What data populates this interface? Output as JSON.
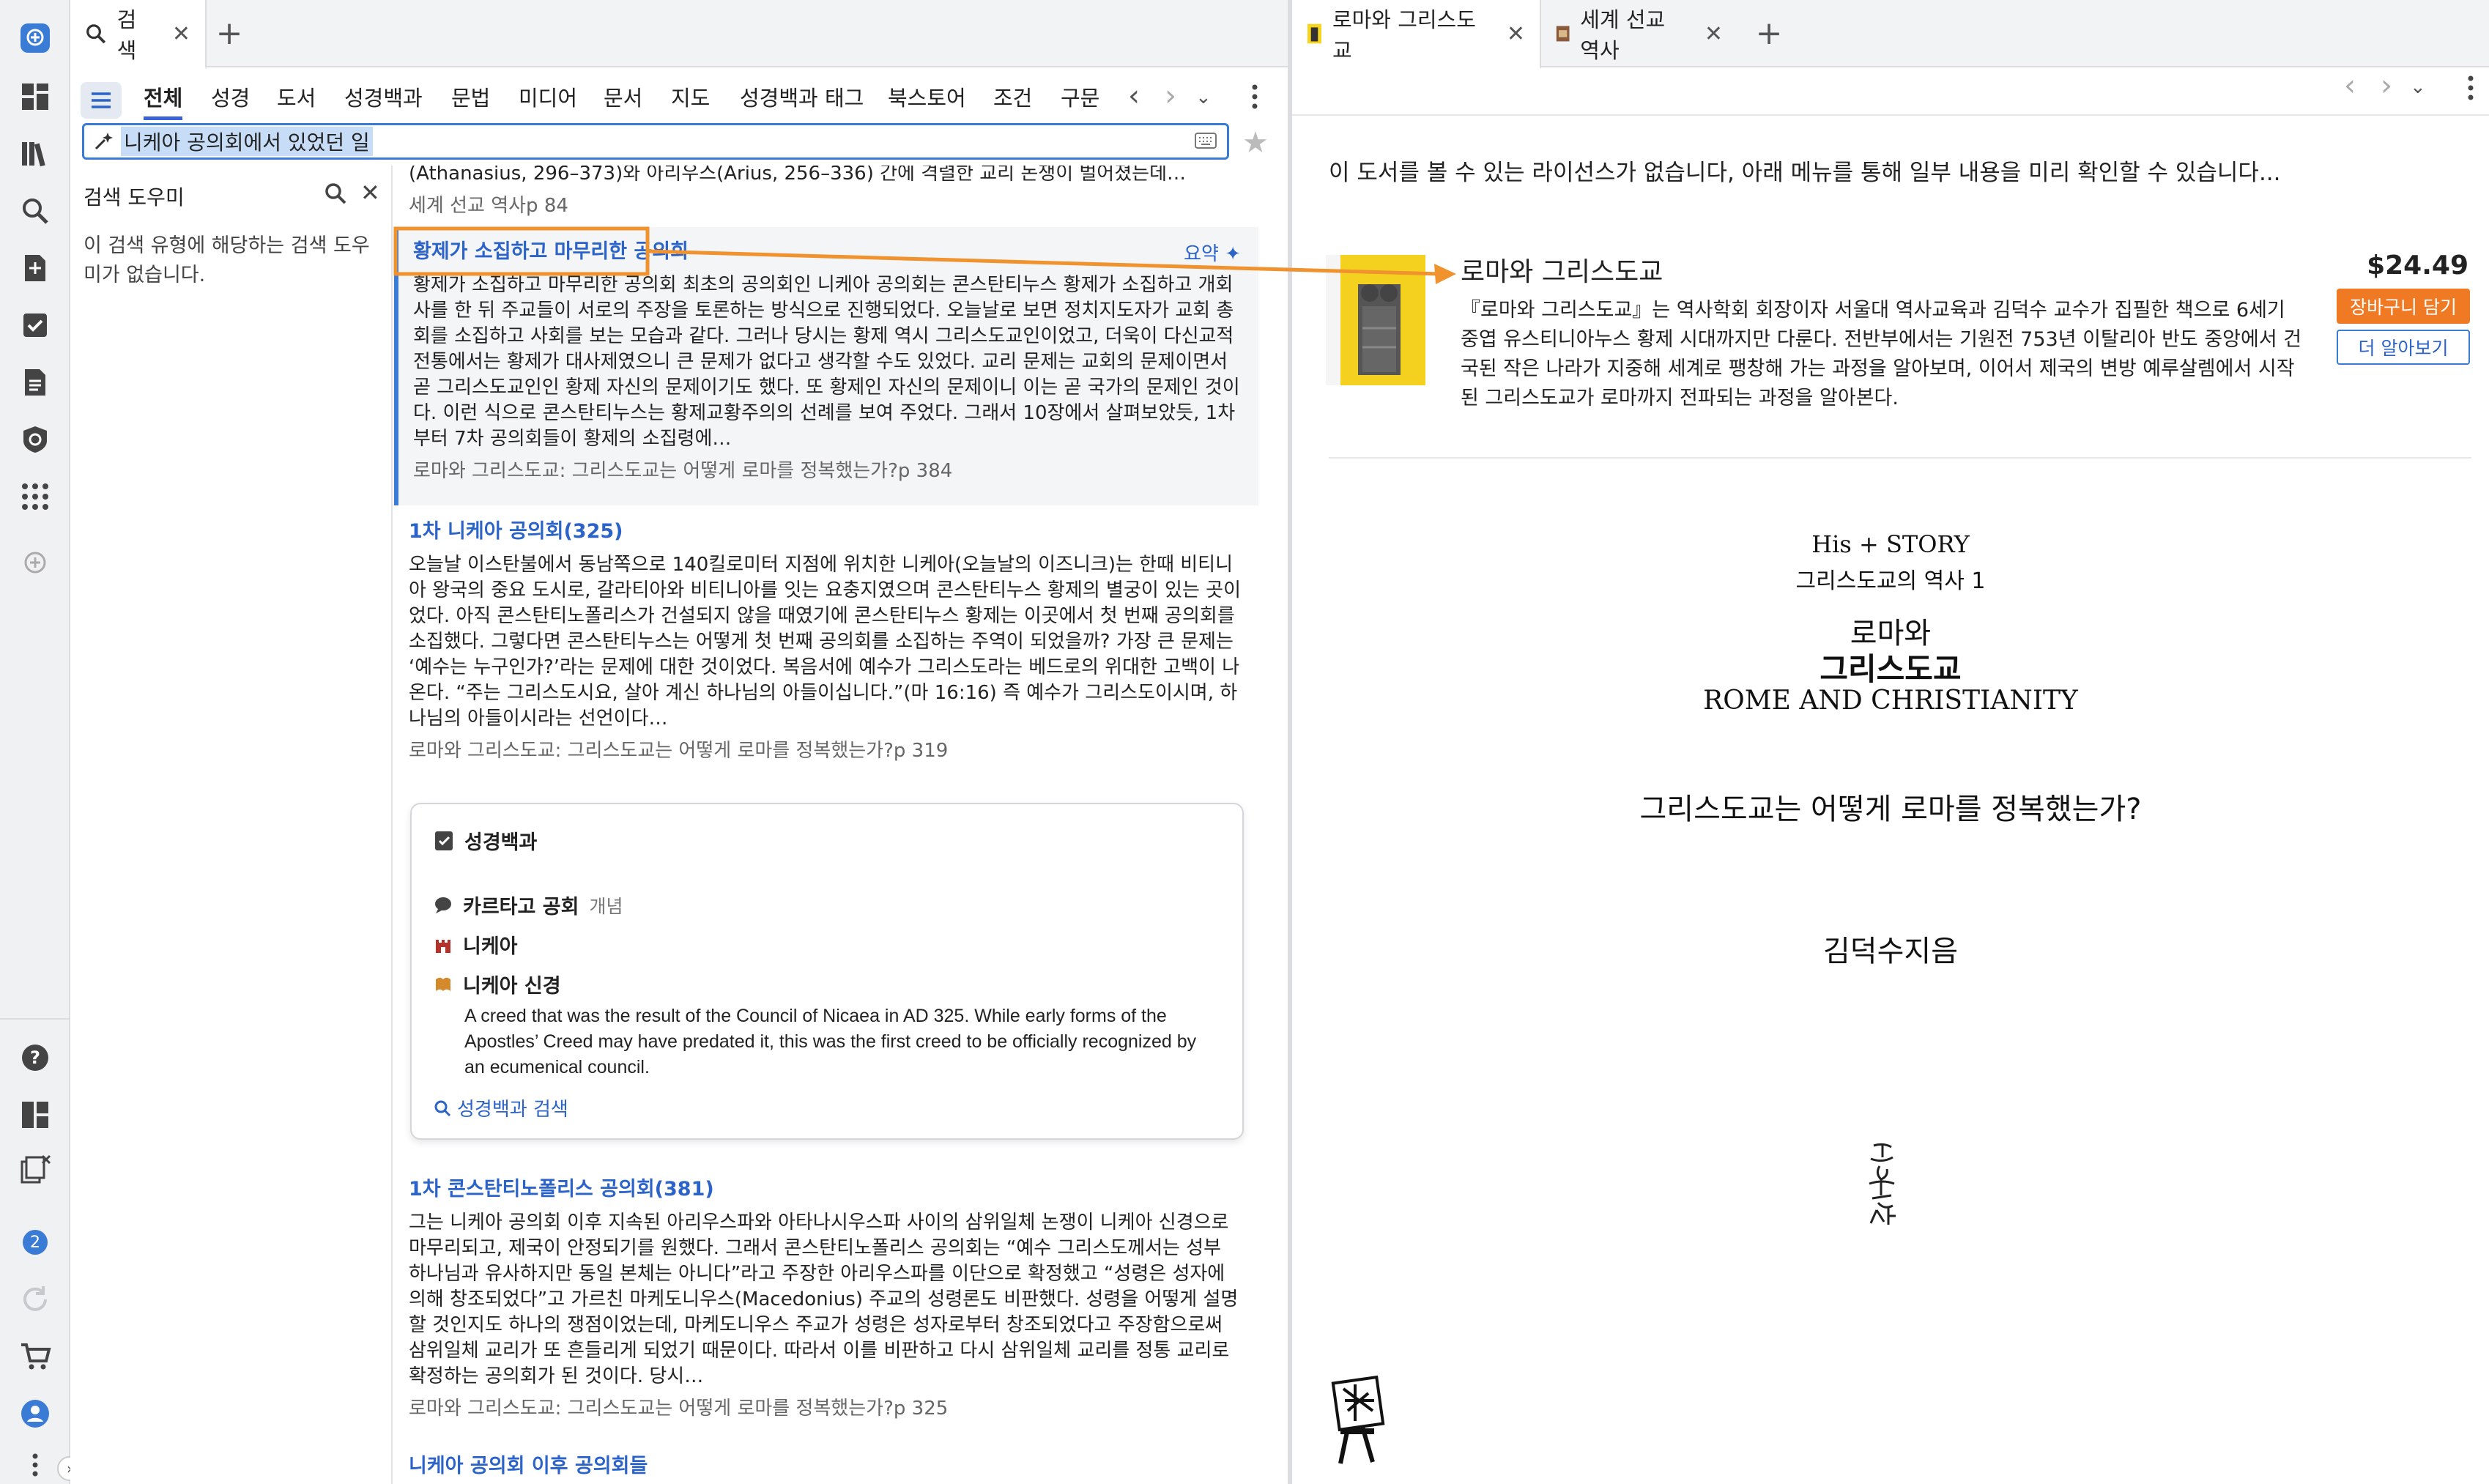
{
  "left_tabs": [
    {
      "label": "검색",
      "icon": "search-icon"
    }
  ],
  "filter_tabs": [
    "전체",
    "성경",
    "도서",
    "성경백과",
    "문법",
    "미디어",
    "문서",
    "지도",
    "성경백과 태그",
    "북스토어",
    "조건",
    "구문"
  ],
  "search": {
    "query": "니케아 공의회에서 있었던 일",
    "placeholder": ""
  },
  "helper": {
    "title": "검색 도우미",
    "message": "이 검색 유형에 해당하는 검색 도우미가 없습니다."
  },
  "results": {
    "top_partial_text": "(Athanasius, 296–373)와 아리우스(Arius, 256–336) 간에 격렬한 교리 논쟁이 벌어졌는데…",
    "top_partial_src": "세계 선교 역사p 84",
    "items": [
      {
        "title": "황제가 소집하고 마무리한 공의회",
        "summary_label": "요약",
        "body": "황제가 소집하고 마무리한 공의회 최초의 공의회인 니케아 공의회는 콘스탄티누스 황제가 소집하고 개회사를 한 뒤 주교들이 서로의 주장을 토론하는 방식으로 진행되었다. 오늘날로 보면 정치지도자가 교회 총회를 소집하고 사회를 보는 모습과 같다. 그러나 당시는 황제 역시 그리스도교인이었고, 더욱이 다신교적 전통에서는 황제가 대사제였으니 큰 문제가 없다고 생각할 수도 있었다. 교리 문제는 교회의 문제이면서 곧 그리스도교인인 황제 자신의 문제이기도 했다. 또 황제인 자신의 문제이니 이는 곧 국가의 문제인 것이다. 이런 식으로 콘스탄티누스는 황제교황주의의 선례를 보여 주었다. 그래서 10장에서 살펴보았듯, 1차부터 7차 공의회들이 황제의 소집령에…",
        "source": "로마와 그리스도교: 그리스도교는 어떻게 로마를 정복했는가?p 384"
      },
      {
        "title": "1차 니케아 공의회(325)",
        "body": "오늘날 이스탄불에서 동남쪽으로 140킬로미터 지점에 위치한 니케아(오늘날의 이즈니크)는 한때 비티니아 왕국의 중요 도시로, 갈라티아와 비티니아를 잇는 요충지였으며 콘스탄티누스 황제의 별궁이 있는 곳이었다. 아직 콘스탄티노폴리스가 건설되지 않을 때였기에 콘스탄티누스 황제는 이곳에서 첫 번째 공의회를 소집했다. 그렇다면 콘스탄티누스는 어떻게 첫 번째 공의회를 소집하는 주역이 되었을까? 가장 큰 문제는 ‘예수는 누구인가?’라는 문제에 대한 것이었다. 복음서에 예수가 그리스도라는 베드로의 위대한 고백이 나온다. “주는 그리스도시요, 살아 계신 하나님의 아들이십니다.”(마 16:16) 즉 예수가 그리스도이시며, 하나님의 아들이시라는 선언이다…",
        "source": "로마와 그리스도교: 그리스도교는 어떻게 로마를 정복했는가?p 319"
      },
      {
        "title": "1차 콘스탄티노폴리스 공의회(381)",
        "body": "그는 니케아 공의회 이후 지속된 아리우스파와 아타나시우스파 사이의 삼위일체 논쟁이 니케아 신경으로 마무리되고, 제국이 안정되기를 원했다. 그래서 콘스탄티노폴리스 공의회는 “예수 그리스도께서는 성부 하나님과 유사하지만 동일 본체는 아니다”라고 주장한 아리우스파를 이단으로 확정했고 “성령은 성자에 의해 창조되었다”고 가르친 마케도니우스(Macedonius) 주교의 성령론도 비판했다. 성령을 어떻게 설명할 것인지도 하나의 쟁점이었는데, 마케도니우스 주교가 성령은 성자로부터 창조되었다고 주장함으로써 삼위일체 교리가 또 흔들리게 되었기 때문이다. 따라서 이를 비판하고 다시 삼위일체 교리를 정통 교리로 확정하는 공의회가 된 것이다. 당시…",
        "source": "로마와 그리스도교: 그리스도교는 어떻게 로마를 정복했는가?p 325"
      },
      {
        "title": "니케아 공의회 이후 공의회들"
      }
    ]
  },
  "encyclopedia": {
    "header": "성경백과",
    "entries": [
      {
        "name": "카르타고 공회",
        "type": "개념",
        "icon": "speech-bubble-icon"
      },
      {
        "name": "니케아",
        "type": "",
        "icon": "castle-icon"
      },
      {
        "name": "니케아 신경",
        "type": "",
        "icon": "document-icon"
      }
    ],
    "creed_desc": "A creed that was the result of the Council of Nicaea in AD 325. While early forms of the Apostles’ Creed may have predated it, this was the first creed to be officially recognized by an ecumenical council.",
    "search_link": "성경백과 검색"
  },
  "right_tabs": [
    {
      "label": "로마와 그리스도교",
      "icon": "book-thumb-icon"
    },
    {
      "label": "세계 선교 역사",
      "icon": "book-thumb-icon"
    }
  ],
  "book": {
    "license_msg": "이 도서를 볼 수 있는 라이선스가 없습니다, 아래 메뉴를 통해 일부 내용을 미리 확인할 수 있습니다...",
    "title": "로마와 그리스도교",
    "price": "$24.49",
    "cart_label": "장바구니 담기",
    "more_label": "더 알아보기",
    "description": "『로마와 그리스도교』는 역사학회 회장이자 서울대 역사교육과 김덕수 교수가 집필한 책으로 6세기 중엽 유스티니아누스 황제 시대까지만 다룬다. 전반부에서는 기원전 753년 이탈리아 반도 중앙에서 건국된 작은 나라가 지중해 세계로 팽창해 가는 과정을 알아보며, 이어서 제국의 변방 예루살렘에서 시작된 그리스도교가 로마까지 전파되는 과정을 알아본다."
  },
  "preview": {
    "series": "His + STORY",
    "volume": "그리스도교의 역사 1",
    "title_line1": "로마와",
    "title_line2": "그리스도교",
    "english_title": "ROME AND CHRISTIANITY",
    "subtitle": "그리스도교는 어떻게 로마를 정복했는가?",
    "author": "김덕수지음",
    "publisher_seal": "홍성사"
  },
  "notification_count": "2",
  "colors": {
    "accent": "#3a62d7",
    "link": "#2b63c8",
    "highlight_box": "#f0922e",
    "cart": "#f07a24"
  }
}
